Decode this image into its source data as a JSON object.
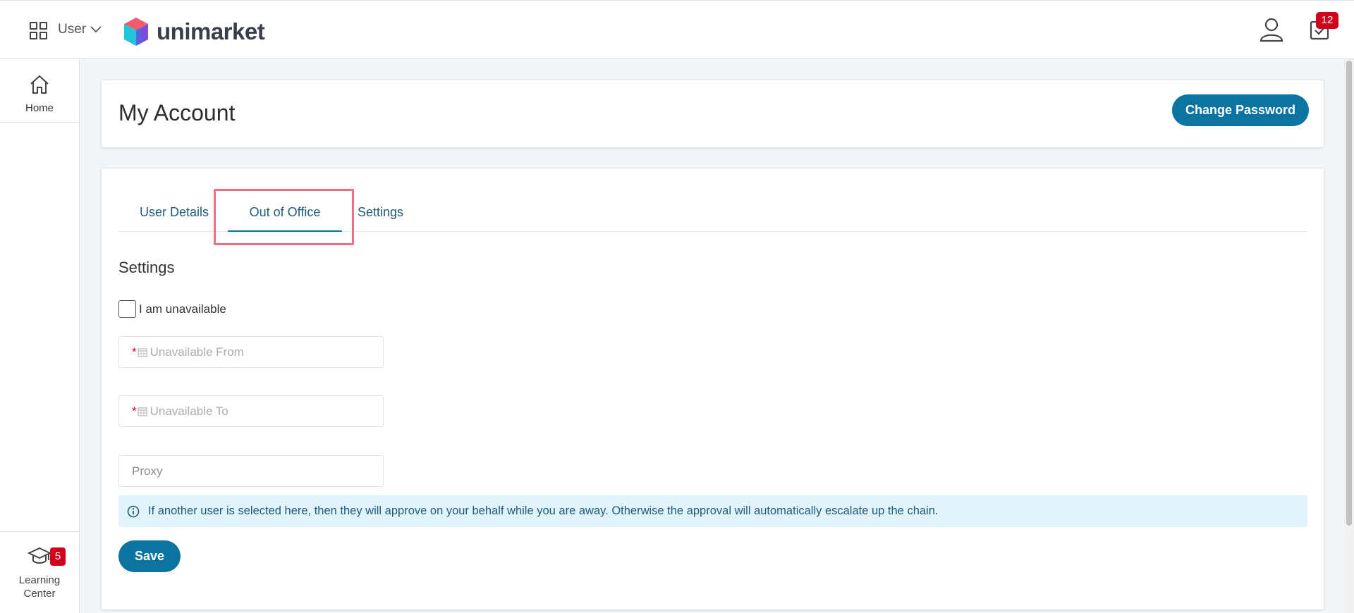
{
  "topbar": {
    "user_menu_label": "User",
    "logo_text": "unimarket",
    "tasks_badge": "12"
  },
  "sidebar": {
    "home_label": "Home",
    "learning_label_line1": "Learning",
    "learning_label_line2": "Center",
    "learning_badge": "5"
  },
  "header": {
    "title": "My Account",
    "change_password_label": "Change Password"
  },
  "tabs": [
    {
      "label": "User Details",
      "active": false
    },
    {
      "label": "Out of Office",
      "active": true
    },
    {
      "label": "Settings",
      "active": false
    }
  ],
  "form": {
    "section_title": "Settings",
    "unavailable_label": "I am unavailable",
    "unavailable_checked": false,
    "unavailable_from_placeholder": "Unavailable From",
    "unavailable_to_placeholder": "Unavailable To",
    "proxy_placeholder": "Proxy",
    "required_marker": "*",
    "info_text": "If another user is selected here, then they will approve on your behalf while you are away. Otherwise the approval will automatically escalate up the chain.",
    "save_label": "Save"
  },
  "colors": {
    "primary": "#0b74a0",
    "badge": "#d0021b",
    "highlight": "#ee6f7f",
    "info_bg": "#e2f4fb"
  }
}
